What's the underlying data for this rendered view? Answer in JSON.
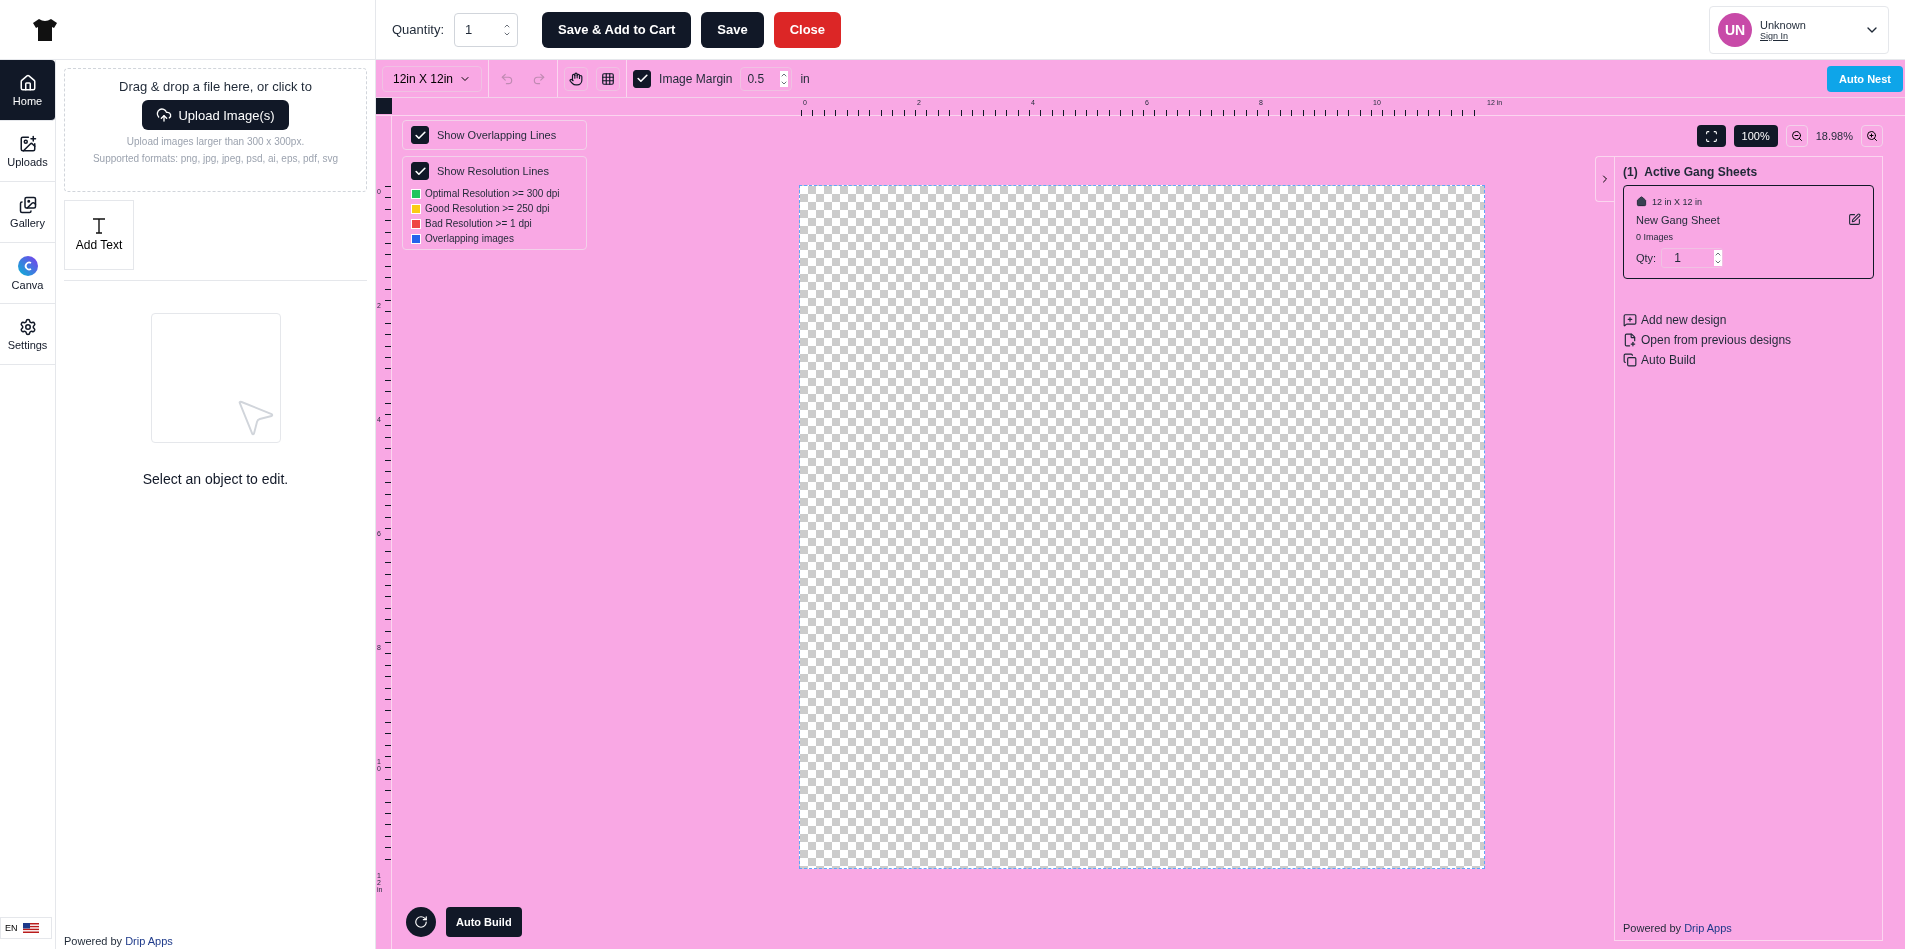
{
  "header": {
    "quantity_label": "Quantity:",
    "quantity_value": "1",
    "buttons": [
      {
        "label": "Save & Add to Cart",
        "kind": "primary"
      },
      {
        "label": "Save",
        "kind": "primary"
      },
      {
        "label": "Close",
        "kind": "danger"
      }
    ],
    "user": {
      "initials": "UN",
      "name": "Unknown",
      "link": "Sign In"
    }
  },
  "nav": {
    "items": [
      {
        "label": "Home",
        "selected": true
      },
      {
        "label": "Uploads",
        "selected": false
      },
      {
        "label": "Gallery",
        "selected": false
      },
      {
        "label": "Canva",
        "selected": false
      },
      {
        "label": "Settings",
        "selected": false
      }
    ],
    "language": "EN"
  },
  "panel": {
    "prompt": "Drag & drop a file here, or click to",
    "upload_button": "Upload Image(s)",
    "hint": "Upload images larger than 300 x 300px.",
    "formats": "Supported formats: png, jpg, jpeg, psd, ai, eps, pdf, svg",
    "add_text": "Add Text",
    "empty_state": "Select an object to edit.",
    "footer_prefix": "Powered by",
    "footer_brand": "Drip Apps"
  },
  "toolbar": {
    "size": "12in X 12in",
    "image_margin": {
      "label": "Image Margin",
      "checked": true,
      "value": "0.5",
      "unit": "in"
    },
    "auto_nest": "Auto Nest"
  },
  "rulers": {
    "horizontal": [
      "0",
      "2",
      "4",
      "6",
      "8",
      "10",
      "12 in"
    ],
    "vertical": [
      "0",
      "2",
      "4",
      "6",
      "8",
      "10",
      "12 in"
    ]
  },
  "overlays": {
    "overlapping": {
      "label": "Show Overlapping Lines",
      "checked": true
    },
    "resolution": {
      "label": "Show Resolution Lines",
      "checked": true,
      "legend": [
        {
          "label": "Optimal Resolution >= 300 dpi",
          "color": "#22c55e"
        },
        {
          "label": "Good Resolution >= 250 dpi",
          "color": "#facc15"
        },
        {
          "label": "Bad Resolution >= 1 dpi",
          "color": "#ef4444"
        },
        {
          "label": "Overlapping images",
          "color": "#2563eb"
        }
      ]
    }
  },
  "zoom": {
    "reset": "100%",
    "value": "18.98%"
  },
  "gang": {
    "count": "(1)",
    "title": "Active Gang Sheets",
    "sheet": {
      "size": "12 in X 12 in",
      "name": "New Gang Sheet",
      "images": "0 Images",
      "qty_label": "Qty:",
      "qty": "1"
    },
    "actions": [
      "Add new design",
      "Open from previous designs",
      "Auto Build"
    ],
    "footer_prefix": "Powered by",
    "footer_brand": "Drip Apps"
  },
  "auto_build": "Auto Build"
}
